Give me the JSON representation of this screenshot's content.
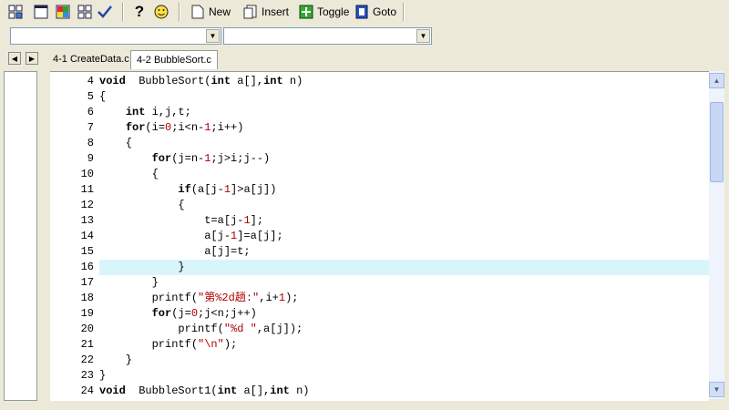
{
  "toolbar": {
    "new_label": "New",
    "insert_label": "Insert",
    "toggle_label": "Toggle",
    "goto_label": "Goto"
  },
  "combos": {
    "left_value": "",
    "right_value": ""
  },
  "tabs": [
    {
      "label": "4-1 CreateData.c"
    },
    {
      "label": "4-2 BubbleSort.c"
    }
  ],
  "editor": {
    "current_line": 16,
    "lines": [
      {
        "n": "4",
        "segs": [
          [
            "kw",
            "void"
          ],
          [
            "",
            "  BubbleSort("
          ],
          [
            "kw",
            "int"
          ],
          [
            "",
            " a[],"
          ],
          [
            "kw",
            "int"
          ],
          [
            "",
            " n)"
          ]
        ]
      },
      {
        "n": "5",
        "segs": [
          [
            "",
            "{"
          ]
        ]
      },
      {
        "n": "6",
        "segs": [
          [
            "",
            "    "
          ],
          [
            "kw",
            "int"
          ],
          [
            "",
            " i,j,t;"
          ]
        ]
      },
      {
        "n": "7",
        "segs": [
          [
            "",
            "    "
          ],
          [
            "kw",
            "for"
          ],
          [
            "",
            "(i="
          ],
          [
            "num",
            "0"
          ],
          [
            "",
            ";i<n-"
          ],
          [
            "num",
            "1"
          ],
          [
            "",
            ";i++)"
          ]
        ]
      },
      {
        "n": "8",
        "segs": [
          [
            "",
            "    {"
          ]
        ]
      },
      {
        "n": "9",
        "segs": [
          [
            "",
            "        "
          ],
          [
            "kw",
            "for"
          ],
          [
            "",
            "(j=n-"
          ],
          [
            "num",
            "1"
          ],
          [
            "",
            ";j>i;j--)"
          ]
        ]
      },
      {
        "n": "10",
        "segs": [
          [
            "",
            "        {"
          ]
        ]
      },
      {
        "n": "11",
        "segs": [
          [
            "",
            "            "
          ],
          [
            "kw",
            "if"
          ],
          [
            "",
            "(a[j-"
          ],
          [
            "num",
            "1"
          ],
          [
            "",
            "]>a[j])"
          ]
        ]
      },
      {
        "n": "12",
        "segs": [
          [
            "",
            "            {"
          ]
        ]
      },
      {
        "n": "13",
        "segs": [
          [
            "",
            "                t=a[j-"
          ],
          [
            "num",
            "1"
          ],
          [
            "",
            "];"
          ]
        ]
      },
      {
        "n": "14",
        "segs": [
          [
            "",
            "                a[j-"
          ],
          [
            "num",
            "1"
          ],
          [
            "",
            "]=a[j];"
          ]
        ]
      },
      {
        "n": "15",
        "segs": [
          [
            "",
            "                a[j]=t;"
          ]
        ]
      },
      {
        "n": "16",
        "segs": [
          [
            "",
            "            }"
          ]
        ]
      },
      {
        "n": "17",
        "segs": [
          [
            "",
            "        }"
          ]
        ]
      },
      {
        "n": "18",
        "segs": [
          [
            "",
            "        printf("
          ],
          [
            "str",
            "\"第%2d趟:\""
          ],
          [
            "",
            ",i+"
          ],
          [
            "num",
            "1"
          ],
          [
            "",
            ");"
          ]
        ]
      },
      {
        "n": "19",
        "segs": [
          [
            "",
            "        "
          ],
          [
            "kw",
            "for"
          ],
          [
            "",
            "(j="
          ],
          [
            "num",
            "0"
          ],
          [
            "",
            ";j<n;j++)"
          ]
        ]
      },
      {
        "n": "20",
        "segs": [
          [
            "",
            "            printf("
          ],
          [
            "str",
            "\"%d \""
          ],
          [
            "",
            ",a[j]);"
          ]
        ]
      },
      {
        "n": "21",
        "segs": [
          [
            "",
            "        printf("
          ],
          [
            "str",
            "\"\\n\""
          ],
          [
            "",
            ");"
          ]
        ]
      },
      {
        "n": "22",
        "segs": [
          [
            "",
            "    }"
          ]
        ]
      },
      {
        "n": "23",
        "segs": [
          [
            "",
            "}"
          ]
        ]
      },
      {
        "n": "24",
        "segs": [
          [
            "kw",
            "void"
          ],
          [
            "",
            "  BubbleSort1("
          ],
          [
            "kw",
            "int"
          ],
          [
            "",
            " a[],"
          ],
          [
            "kw",
            "int"
          ],
          [
            "",
            " n)"
          ]
        ]
      }
    ]
  },
  "icons": [
    "grid-icon",
    "window-icon",
    "colored-grid-icon",
    "tile-icon",
    "check-icon",
    "help-icon",
    "smiley-icon",
    "new-doc-icon",
    "insert-icon",
    "toggle-icon",
    "goto-icon"
  ],
  "colors": {
    "highlight_line": "#d8f5fb",
    "string": "#b00000",
    "number": "#b00000"
  }
}
